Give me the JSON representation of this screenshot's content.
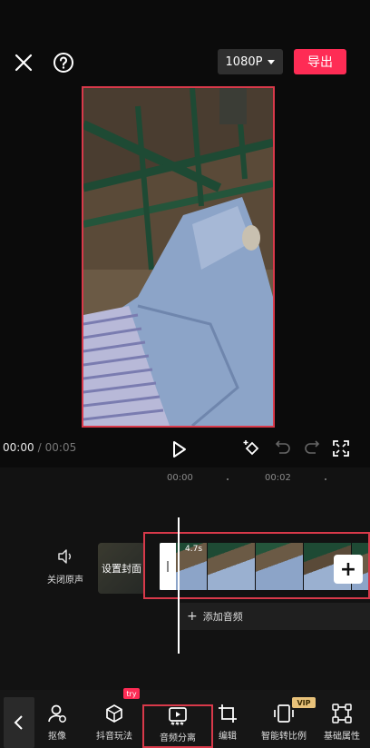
{
  "topbar": {
    "resolution": "1080P",
    "export_label": "导出"
  },
  "playback": {
    "current_time": "00:00",
    "separator": "/",
    "total_time": "00:05"
  },
  "timeline": {
    "ruler_labels": [
      "00:00",
      "00:02"
    ],
    "mute_label": "关闭原声",
    "cover_label_line1": "设置",
    "cover_label_line2": "封面",
    "clip_duration": "4.7s",
    "add_audio_label": "添加音频"
  },
  "toolbar": {
    "items": [
      {
        "label": "抠像",
        "icon": "person-cutout-icon"
      },
      {
        "label": "抖音玩法",
        "icon": "cube-icon",
        "badge": "try"
      },
      {
        "label": "音频分离",
        "icon": "audio-separate-icon"
      },
      {
        "label": "编辑",
        "icon": "crop-icon"
      },
      {
        "label": "智能转比例",
        "icon": "aspect-ratio-icon",
        "badge": "VIP"
      },
      {
        "label": "基础属性",
        "icon": "transform-icon"
      }
    ]
  },
  "colors": {
    "accent": "#fe2c55",
    "highlight_border": "#d8394a",
    "background": "#0b0b0b"
  }
}
